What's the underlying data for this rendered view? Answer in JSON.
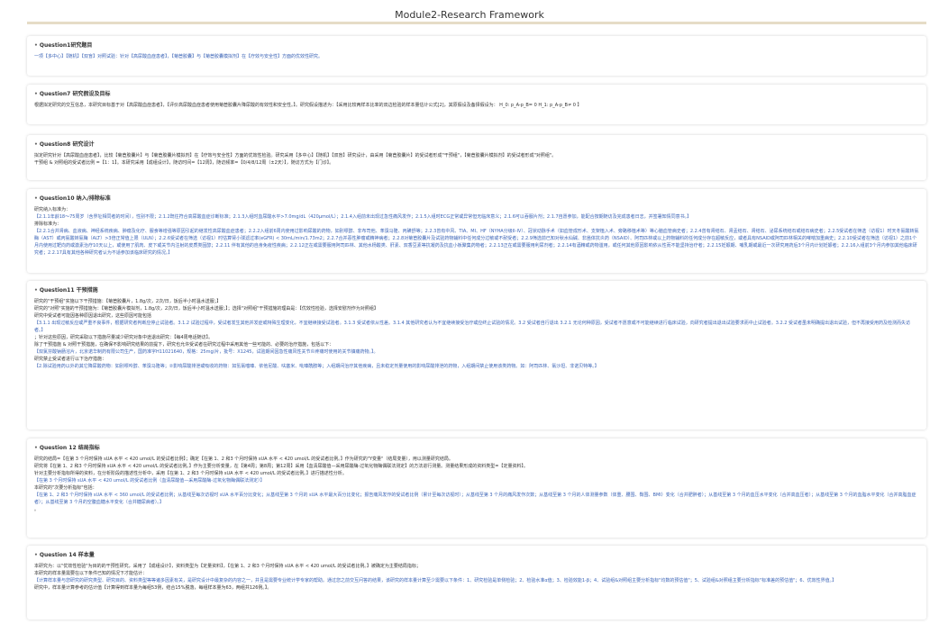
{
  "app": {
    "title": "Module2-Research Framework"
  },
  "sections": [
    {
      "heading": "Question1研究题目",
      "lines": [
        "一项【多中心】【随机】【双盲】对照试验：针对【高尿酸血症患者】，【菊苣胶囊】与【菊苣胶囊模拟剂】在【疗效与安全性】方面的优效性研究。"
      ]
    },
    {
      "heading": "Question7 研究假设及目标",
      "lines": [
        "根据拟定研究的交互信息，本研究目标基于对【高尿酸血症患者】，【评价高尿酸血症患者使用菊苣胶囊片降尿酸的有效性和安全性。】。研究假设描述为：【采用比较两样本比率的双边检验的样本量估计公式[2]，其原假设及备择假设为： H_0: p_A-p_B= 0 H_1: p_A-p_B≠ 0 】"
      ]
    },
    {
      "heading": "Question8 研究设计",
      "lines": [
        "拟定研究针对【高尿酸血症患者】，比较【菊苣胶囊片】与【菊苣胶囊片模拟剂】在【疗效与安全性】方面的优效性检验。研究采用【多中心】【随机】【双盲】研究设计，由采用【菊苣胶囊片】的受试者形成\"干预组\"，【菊苣胶囊片模拟剂】的受试者形成\"对照组\"。",
        "干预组 & 对照组的受试者比例 =【1：1】。本研究采用【成组设计】，随访时间=【12周】，随访频率=【0/4/8/12周（±2天）】，随访方式为【门诊】。"
      ]
    },
    {
      "heading": "Question10 纳入/排除标准",
      "lines": [
        "研究纳入标准为：",
        "【2.1.1年龄18～75周岁（含界址相同者的时间），性别不限；2.1.2既往符合高尿酸血症诊断标准；2.1.3入组时血尿酸水平>7.0mg/dL（420μmol/L）；2.1.4入组前未出现过急性痛风发作；2.1.5入组时ECG正常或异常但无临床意义；2.1.6可以吞服片剂；2.1.7自愿参加，能配合按期随访及完成患者日志，并签署知情同意书。】",
        "排除标准为：",
        "【2.2.1合并肾病、血液病、神经系统疾病、肿瘤及化疗、服食等增强等原因引起的继发性高尿酸血症患者；2.2.2入组前6周内使用过影响尿酸的药物，如别嘌醇、非布司他、苯溴马隆、丙磺舒等；2.2.3曾有中风、TIA、MI、HF（NYHA分级II-IV）、冠状动脉手术（如血管成形术、支架植入术、旁路移植术等）等心脑血管病史者；2.2.4曾有肾结石、肾盂结石、肾结石、泌尿系统结石或结石病史者；2.2.5受试者在筛选（访视1）时天冬氨酸转氨酶（AST）或丙氨酸转氨酶（ALT）>3倍正常值上限（ULN）；2.2.6受试者在筛选（访视1）时估算肾小球滤过率(eGFR) < 30mL/min/1.73m2；2.2.7合并恶性肿瘤或精神病者；2.2.8对菊苣胶囊片及试验药物辅料中任何成分过敏或不耐受者；2.2.9筛选前已知对秋水仙碱、非甾体抗炎药（NSAID）、阿司匹林或以上药物辅料的任何成分存在超敏反应，或者具有NSAID或阿司匹林相关的哮喘加重病史；2.2.10受试者在筛选（访视1）之前1个月内使用过靶向药或激素治疗10天以上，或使用了肌肉、皮下或关节内注射的皮质类固醇；2.2.11 伴有其他的自身免疫性疾病；2.2.12正在或需要服用阿司匹林、其他水杨酸类、肝素、双香豆素等抗凝药及抗血小板聚集药物者；2.2.13正在或需要服用利尿剂者；2.2.14有酒精或药物滥用，或任何其他原因影响依从性而不能坚持治疗者；2.2.15妊娠期、哺乳期或最近一次研究用药后3个月内计划妊娠者；2.2.16入组前3个月内参加其他临床研究者；2.2.17具有其他各种研究者认为不适参加该临床研究的情况。】"
      ]
    },
    {
      "heading": "Question11 干预措施",
      "lines": [
        "研究的\"干预组\"实施以下干预措施：【菊苣胶囊片，1.8g/次，2次/日，饭后半小时温水送服；】",
        "研究的\"对照\"实施的干预措施为：【菊苣胶囊片模拟剂，1.8g/次，2次/日，饭后半小时温水送服；】；选择\"对照组\"干预措施的理由是：【优效性检验，选择安慰剂作为对照组】",
        "研究中受试者可能因各种原因退出研究，这些原因可能包括",
        "【3.1.1 出现过敏反应或严重不良事件，根据研究者判断应停止试验者。3.1.2 试验过程中，受试者发生其他并发症或特殊生理变化，不宜继续接受试验者。3.1.3 受试者依从性差。3.1.4 其他研究者认为不宜继续接受治疗或应终止试验的情况。3.2 受试者自行退出 3.2.1 无论何种原因，受试者不愿意或不可能继续进行临床试验，向研究者提出退出试验要求而中止试验者。3.2.2 受试者虽未明确提出退出试验，但不再接受用药及检测而失访者。】",
        "；针对这些原因，研究采取以下措施尽量减少研究对象中途退出研究：【每4周电话随访】。",
        "除了干预措施 & 对照干预措施，在确保不影响研究结果的前提下，研究也允许受试者在研究过程中采用其他一些可能的、必要的治疗措施，包括以下：",
        "【双氯芬酸钠肠溶片，北京诺华制药有限公司生产，国药准字H11021640，规格：25mg/片，批号：X1245，试验期间因急性痛风性关节炎疼痛时使用的关节镇痛药物。】。",
        "研究禁止受试者进行以下治疗措施：",
        "【2.除试验用药以外的其它降尿酸药物：如别嘌呤醇、苯溴马隆等；②影响尿酸排泄或吸收的药物：如氢氯噻嗪、依他尼酸、呋塞米、吡嗪酰胺等；入组期间治疗其他疾病，且未稳定剂量使用的影响尿酸排泄的药物，入组期间禁止使用该类药物。如：阿司匹林、氯沙坦、非诺贝特等。】"
      ]
    },
    {
      "heading": "Question 12 结局指标",
      "lines": [
        "研究的结局=【在第 3 个月时保持 sUA 水平 < 420 umol/L 的受试者比例】；确定【在第 1、2 和3 个月时保持 sUA 水平 < 420 umol/L 的受试者比例。】作为研究的\"Y变量\"（结局变量），用以测量研究结局。",
        "研究将【在第 1、2 和3 个月时保持 sUA 水平 < 420 umol/L 的受试者比例。】作为主要分析变量，在【第4周；第8周；第12周】采用【血清尿酸值—采用尿酸酶-过氧化物酶偶联法测定】的方法进行测量。测量结果形成的资料类型=【定量资料】。",
        "针对主要分析指标所得的资料，在分析阶段的描述性分析中，采用【在第 1、2 和3 个月时保持 sUA 水平 < 420 umol/L 的受试者比例。】进行描述性分析。",
        "【在第 3 个月时保持 sUA 水平 < 420 umol/L 的受试者比例（血清尿酸值—采用尿酸酶-过氧化物酶偶联法测定）】",
        "本研究的\"次要分析指标\"包括：",
        "【在第 1、2 和3 个月时保持 sUA 水平 < 360 umol/L 的受试者比例；从基线至每次访视时 sUA 水平百分比变化；从基线至第 3 个月的 sUA 水平最大百分比变化；报告痛风发作的受试者比例（累计至每次访视时）；从基线至第 3 个月的痛风发作次数；从基线至第 3 个月的人体测量参数（体重、腰围、臀围、BMI）变化（合并肥胖者）；从基线至第 3 个月的血压水平变化（合并高血压者）；从基线至第 3 个月的血脂水平变化（合并高脂血症者）；从基线至第 3 个月的空腹血糖水平变化（合并糖尿病者）。】",
        "。"
      ]
    },
    {
      "heading": "Question 14 样本量",
      "lines": [
        "本研究为：以\"优效性检验\"为目的的干预性研究，采用了【成组设计】，资料类型为【定量资料】，【在第 1、2 和3 个月时保持 sUA 水平 < 420 umol/L 的受试者比例。】被确定为主要结局指标；",
        "本研究的样本量需要在以下条件已知的情况下才能估计：",
        "【计算样本量与您研究的研究类型、研究目的、资料类型等等诸多因素有关，是研究设计中最复杂的内容之一，并且是需要专业统计学专家的帮助。通过您之前交互问答的结果，该研究的样本量计算至少需要以下条件：1、研究检验是单侧检验；2、检验水准α值；3、检验效能1-β；4、试验组&对照组主要分析指标\"均数的预估值\"；5、试验组&对照组主要分析指标\"标准差的预估值\"；6、优效性界值。】",
        "研究中，样本量计算参考的估计值【计算得到样本量为每组53例，结合15%脱落，每组样本量为63，两组共126例。】。"
      ]
    }
  ]
}
